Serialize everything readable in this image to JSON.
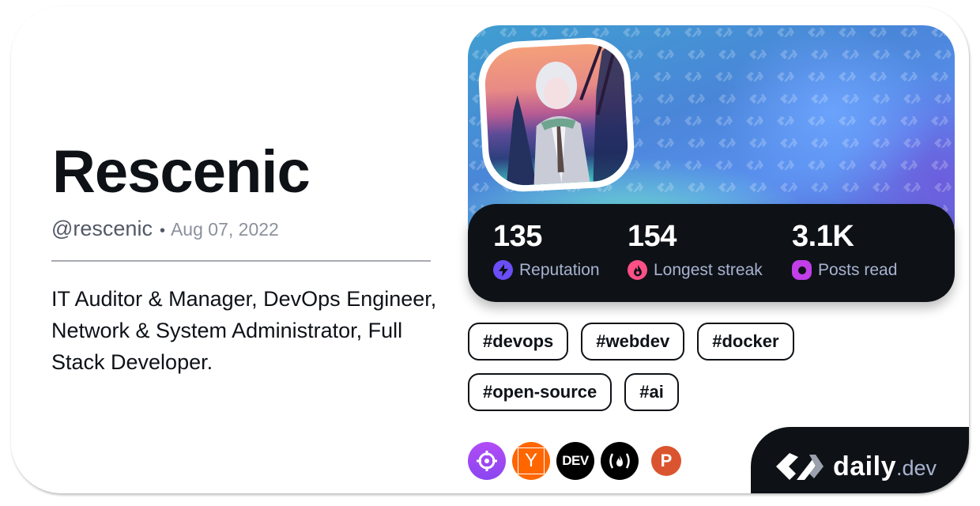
{
  "profile": {
    "name": "Rescenic",
    "handle": "@rescenic",
    "separator": "•",
    "joined": "Aug 07, 2022",
    "bio": "IT Auditor & Manager, DevOps Engineer, Network & System Administrator, Full Stack Developer."
  },
  "stats": [
    {
      "value": "135",
      "label": "Reputation",
      "icon": "reputation-bolt-icon",
      "color": "#6b4ef8"
    },
    {
      "value": "154",
      "label": "Longest streak",
      "icon": "streak-flame-icon",
      "color": "#fe5087"
    },
    {
      "value": "3.1K",
      "label": "Posts read",
      "icon": "posts-read-ring-icon",
      "color": "#c13ee8"
    }
  ],
  "tags": [
    "#devops",
    "#webdev",
    "#docker",
    "#open-source",
    "#ai"
  ],
  "sources": [
    {
      "name": "crosshair-source",
      "bg": "#9a46f5",
      "glyph": "target"
    },
    {
      "name": "y-combinator-source",
      "bg": "#ff6600",
      "glyph": "Y"
    },
    {
      "name": "dev-to-source",
      "bg": "#000000",
      "glyph": "DEV"
    },
    {
      "name": "freecodecamp-source",
      "bg": "#000000",
      "glyph": "(🔥)"
    },
    {
      "name": "product-hunt-source",
      "bg": "#da552f",
      "glyph": "P"
    }
  ],
  "brand": {
    "daily": "daily",
    "dev": ".dev"
  },
  "colors": {
    "text": "#0e1217",
    "muted": "#525866",
    "stat_label": "#a8b3cf",
    "dark": "#0e1217"
  }
}
